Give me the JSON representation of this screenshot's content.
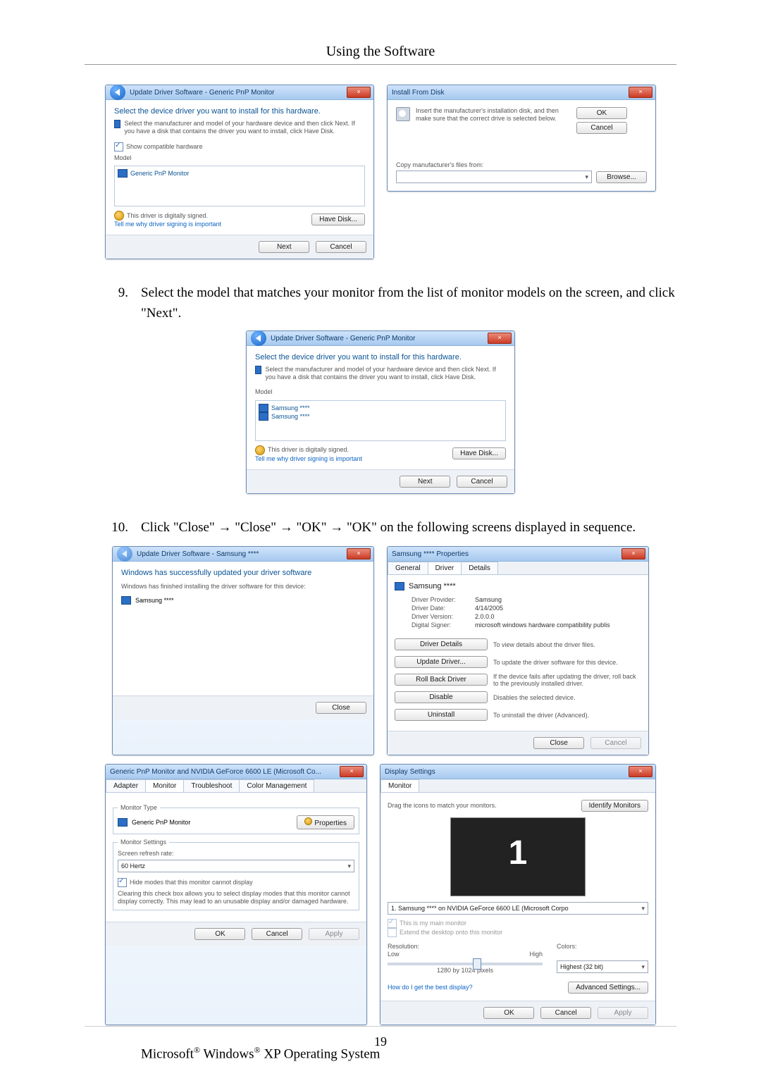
{
  "header": {
    "title": "Using the Software"
  },
  "steps": {
    "s9": {
      "num": "9.",
      "text": "Select the model that matches your monitor from the list of monitor models on the screen, and click \"Next\"."
    },
    "s10": {
      "num": "10.",
      "text": "Click \"Close\" → \"Close\" → \"OK\" → \"OK\" on the following screens displayed in sequence."
    }
  },
  "wiz1": {
    "title": "Update Driver Software - Generic PnP Monitor",
    "heading": "Select the device driver you want to install for this hardware.",
    "note": "Select the manufacturer and model of your hardware device and then click Next. If you have a disk that contains the driver you want to install, click Have Disk.",
    "show_compat": "Show compatible hardware",
    "col_model": "Model",
    "item": "Generic PnP Monitor",
    "signed": "This driver is digitally signed.",
    "why": "Tell me why driver signing is important",
    "have_disk": "Have Disk...",
    "next": "Next",
    "cancel": "Cancel"
  },
  "install_disk": {
    "title": "Install From Disk",
    "msg": "Insert the manufacturer's installation disk, and then make sure that the correct drive is selected below.",
    "ok": "OK",
    "cancel": "Cancel",
    "copy_from": "Copy manufacturer's files from:",
    "browse": "Browse..."
  },
  "wiz2": {
    "title": "Update Driver Software - Generic PnP Monitor",
    "heading": "Select the device driver you want to install for this hardware.",
    "note": "Select the manufacturer and model of your hardware device and then click Next. If you have a disk that contains the driver you want to install, click Have Disk.",
    "col_model": "Model",
    "items": [
      "Samsung ****",
      "Samsung ****"
    ],
    "signed": "This driver is digitally signed.",
    "why": "Tell me why driver signing is important",
    "have_disk": "Have Disk...",
    "next": "Next",
    "cancel": "Cancel"
  },
  "done": {
    "title": "Update Driver Software - Samsung ****",
    "heading": "Windows has successfully updated your driver software",
    "sub": "Windows has finished installing the driver software for this device:",
    "device": "Samsung ****",
    "close": "Close"
  },
  "props": {
    "title": "Samsung **** Properties",
    "tabs": {
      "general": "General",
      "driver": "Driver",
      "details": "Details"
    },
    "name": "Samsung ****",
    "provider_k": "Driver Provider:",
    "provider_v": "Samsung",
    "date_k": "Driver Date:",
    "date_v": "4/14/2005",
    "ver_k": "Driver Version:",
    "ver_v": "2.0.0.0",
    "signer_k": "Digital Signer:",
    "signer_v": "microsoft windows hardware compatibility publis",
    "btn_details": "Driver Details",
    "desc_details": "To view details about the driver files.",
    "btn_update": "Update Driver...",
    "desc_update": "To update the driver software for this device.",
    "btn_rollback": "Roll Back Driver",
    "desc_rollback": "If the device fails after updating the driver, roll back to the previously installed driver.",
    "btn_disable": "Disable",
    "desc_disable": "Disables the selected device.",
    "btn_uninstall": "Uninstall",
    "desc_uninstall": "To uninstall the driver (Advanced).",
    "close": "Close",
    "cancel": "Cancel"
  },
  "monprops": {
    "title": "Generic PnP Monitor and NVIDIA GeForce 6600 LE (Microsoft Co...",
    "tabs": {
      "adapter": "Adapter",
      "monitor": "Monitor",
      "troubleshoot": "Troubleshoot",
      "color": "Color Management"
    },
    "type_legend": "Monitor Type",
    "type_name": "Generic PnP Monitor",
    "btn_props": "Properties",
    "settings_legend": "Monitor Settings",
    "refresh_lbl": "Screen refresh rate:",
    "refresh_val": "60 Hertz",
    "hide_chk": "Hide modes that this monitor cannot display",
    "hide_note": "Clearing this check box allows you to select display modes that this monitor cannot display correctly. This may lead to an unusable display and/or damaged hardware.",
    "ok": "OK",
    "cancel": "Cancel",
    "apply": "Apply"
  },
  "disp": {
    "title": "Display Settings",
    "tab": "Monitor",
    "drag": "Drag the icons to match your monitors.",
    "identify": "Identify Monitors",
    "preview_num": "1",
    "sel": "1. Samsung **** on NVIDIA GeForce 6600 LE (Microsoft Corpo",
    "main_chk": "This is my main monitor",
    "extend_chk": "Extend the desktop onto this monitor",
    "res_lbl": "Resolution:",
    "low": "Low",
    "high": "High",
    "res_val": "1280 by 1024 pixels",
    "colors_lbl": "Colors:",
    "colors_val": "Highest (32 bit)",
    "best": "How do I get the best display?",
    "adv": "Advanced Settings...",
    "ok": "OK",
    "cancel": "Cancel",
    "apply": "Apply"
  },
  "footer": {
    "os_line_pre": "Microsoft",
    "reg": "®",
    "os_mid": " Windows",
    "os_tail": " XP Operating System",
    "page": "19"
  }
}
